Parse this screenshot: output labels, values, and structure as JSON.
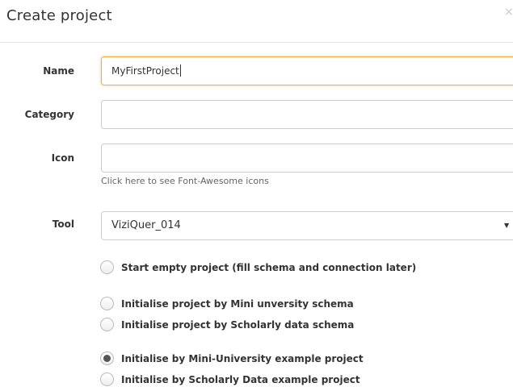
{
  "dialog": {
    "title": "Create project",
    "close_glyph": "×"
  },
  "form": {
    "name": {
      "label": "Name",
      "value": "MyFirstProject"
    },
    "category": {
      "label": "Category",
      "value": ""
    },
    "icon": {
      "label": "Icon",
      "value": "",
      "help_link": "Click here",
      "help_rest": " to see Font-Awesome icons"
    },
    "tool": {
      "label": "Tool",
      "selected": "ViziQuer_014",
      "arrow": "▼"
    }
  },
  "options": [
    {
      "label": "Start empty project (fill schema and connection later)",
      "checked": false
    },
    {
      "label": "Initialise project by Mini unversity schema",
      "checked": false
    },
    {
      "label": "Initialise project by Scholarly data schema",
      "checked": false
    },
    {
      "label": "Initialise by Mini-University example project",
      "checked": true
    },
    {
      "label": "Initialise by Scholarly Data example project",
      "checked": false
    }
  ],
  "colors": {
    "focus_border": "#f0ad4e",
    "input_border": "#cccccc",
    "text": "#333333"
  },
  "icons": {
    "close": "close-icon",
    "dropdown": "chevron-down-icon"
  }
}
